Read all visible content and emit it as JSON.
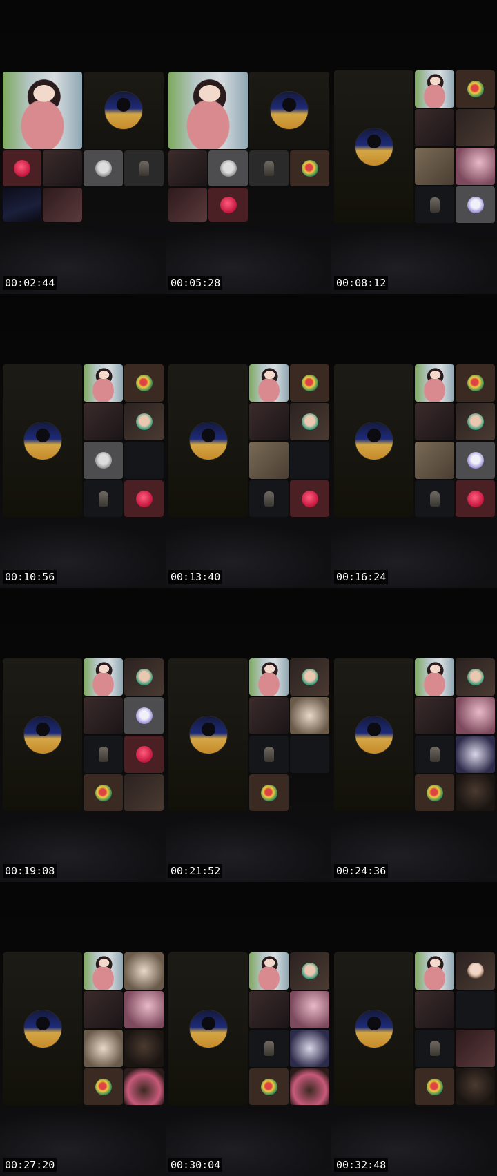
{
  "title": "",
  "frames": [
    {
      "timestamp": "00:02:44"
    },
    {
      "timestamp": "00:05:28"
    },
    {
      "timestamp": "00:08:12"
    },
    {
      "timestamp": "00:10:56"
    },
    {
      "timestamp": "00:13:40"
    },
    {
      "timestamp": "00:16:24"
    },
    {
      "timestamp": "00:19:08"
    },
    {
      "timestamp": "00:21:52"
    },
    {
      "timestamp": "00:24:36"
    },
    {
      "timestamp": "00:27:20"
    },
    {
      "timestamp": "00:30:04"
    },
    {
      "timestamp": "00:32:48"
    }
  ]
}
